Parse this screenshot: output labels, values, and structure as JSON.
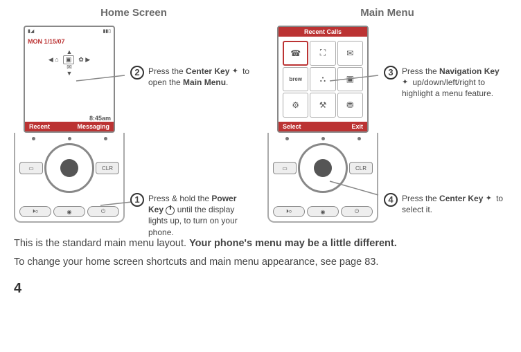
{
  "headings": {
    "left": "Home Screen",
    "right": "Main Menu"
  },
  "homescreen": {
    "date": "MON 1/15/07",
    "time": "8:45am",
    "soft_left": "Recent",
    "soft_right": "Messaging"
  },
  "mainmenu": {
    "title": "Recent Calls",
    "soft_left": "Select",
    "soft_right": "Exit"
  },
  "callouts": {
    "c1": {
      "num": "1",
      "text_a": "Press & hold the ",
      "bold_a": "Power Key",
      "text_b": " until the display lights up, to turn on your phone."
    },
    "c2": {
      "num": "2",
      "text_a": "Press the ",
      "bold_a": "Center Key",
      "text_b": " to open the ",
      "bold_b": "Main Menu",
      "text_c": "."
    },
    "c3": {
      "num": "3",
      "text_a": "Press the ",
      "bold_a": "Navigation Key",
      "text_b": " up/down/left/right to highlight a menu feature."
    },
    "c4": {
      "num": "4",
      "text_a": "Press the ",
      "bold_a": "Center Key",
      "text_b": " to select it."
    }
  },
  "body": {
    "line1_a": "This is the standard main menu layout. ",
    "line1_b": "Your phone's menu may be a little different.",
    "line2": "To change your home screen shortcuts and main menu appearance, see page 83."
  },
  "page": "4",
  "keys": {
    "clr": "CLR"
  }
}
